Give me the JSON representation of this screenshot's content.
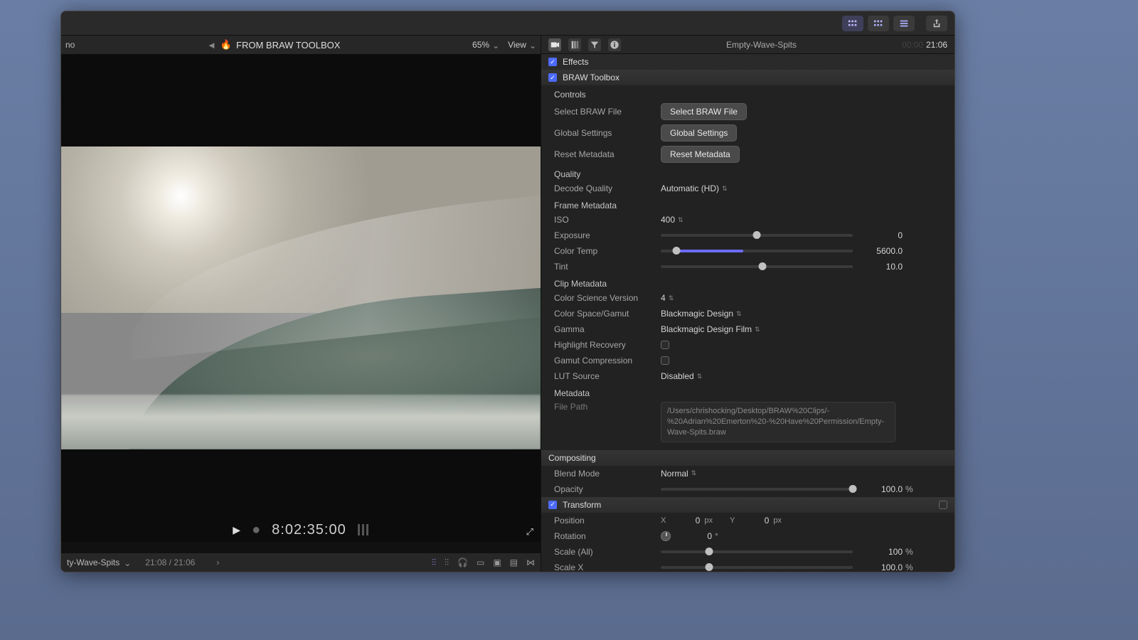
{
  "titlebar": {
    "share_tip": "Share"
  },
  "viewer": {
    "left_text": "no",
    "title": "FROM BRAW TOOLBOX",
    "zoom": "65%",
    "view_label": "View",
    "timecode": "8:02:35:00"
  },
  "footer": {
    "clip_name": "ty-Wave-Spits",
    "time": "21:08 / 21:06"
  },
  "inspector": {
    "clip_name": "Empty-Wave-Spits",
    "time_cur": "00:00",
    "time_dur": "21:06",
    "effects_label": "Effects",
    "braw_label": "BRAW Toolbox",
    "controls": {
      "heading": "Controls",
      "select_label": "Select BRAW File",
      "select_btn": "Select BRAW File",
      "global_label": "Global Settings",
      "global_btn": "Global Settings",
      "reset_label": "Reset Metadata",
      "reset_btn": "Reset Metadata"
    },
    "quality": {
      "heading": "Quality",
      "decode_label": "Decode Quality",
      "decode_value": "Automatic (HD)"
    },
    "frame": {
      "heading": "Frame Metadata",
      "iso_label": "ISO",
      "iso_value": "400",
      "exposure_label": "Exposure",
      "exposure_value": "0",
      "temp_label": "Color Temp",
      "temp_value": "5600.0",
      "tint_label": "Tint",
      "tint_value": "10.0"
    },
    "clip": {
      "heading": "Clip Metadata",
      "csv_label": "Color Science Version",
      "csv_value": "4",
      "cspace_label": "Color Space/Gamut",
      "cspace_value": "Blackmagic Design",
      "gamma_label": "Gamma",
      "gamma_value": "Blackmagic Design Film",
      "hr_label": "Highlight Recovery",
      "gc_label": "Gamut Compression",
      "lut_label": "LUT Source",
      "lut_value": "Disabled"
    },
    "meta": {
      "heading": "Metadata",
      "path_label": "File Path",
      "path_value": "/Users/chrishocking/Desktop/BRAW%20Clips/-%20Adrian%20Emerton%20-%20Have%20Permission/Empty-Wave-Spits.braw"
    },
    "comp": {
      "heading": "Compositing",
      "blend_label": "Blend Mode",
      "blend_value": "Normal",
      "opacity_label": "Opacity",
      "opacity_value": "100.0",
      "opacity_unit": "%"
    },
    "transform": {
      "heading": "Transform",
      "pos_label": "Position",
      "pos_x_lbl": "X",
      "pos_x": "0",
      "pos_x_unit": "px",
      "pos_y_lbl": "Y",
      "pos_y": "0",
      "pos_y_unit": "px",
      "rot_label": "Rotation",
      "rot_value": "0",
      "rot_unit": "°",
      "scale_all_label": "Scale (All)",
      "scale_all": "100",
      "scale_unit": "%",
      "scale_x_label": "Scale X",
      "scale_x": "100.0"
    }
  }
}
